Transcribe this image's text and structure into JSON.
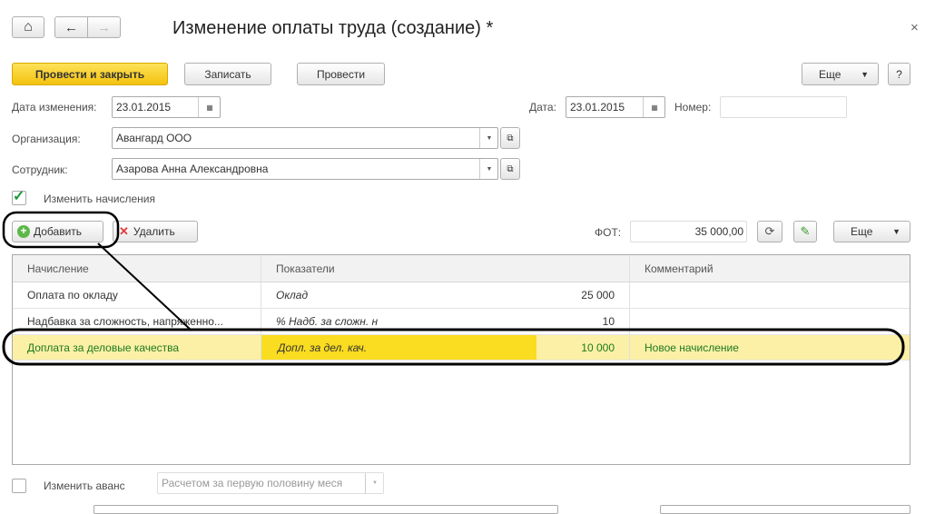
{
  "header": {
    "title": "Изменение оплаты труда (создание) *",
    "close": "×",
    "home": "⌂",
    "back": "←",
    "forward": "→"
  },
  "toolbar": {
    "post_close": "Провести и закрыть",
    "save": "Записать",
    "post": "Провести",
    "more": "Еще",
    "help": "?"
  },
  "form": {
    "change_date_label": "Дата изменения:",
    "change_date": "23.01.2015",
    "date_label": "Дата:",
    "date": "23.01.2015",
    "number_label": "Номер:",
    "number": "",
    "org_label": "Организация:",
    "org": "Авангард ООО",
    "employee_label": "Сотрудник:",
    "employee": "Азарова Анна Александровна",
    "change_accruals_label": "Изменить начисления",
    "change_accruals_checked": true
  },
  "table_toolbar": {
    "add": "Добавить",
    "delete": "Удалить",
    "fot_label": "ФОТ:",
    "fot": "35 000,00",
    "more": "Еще"
  },
  "table": {
    "columns": [
      "Начисление",
      "Показатели",
      "Комментарий"
    ],
    "rows": [
      {
        "accrual": "Оплата по окладу",
        "indicator": "Оклад",
        "value": "25 000",
        "comment": ""
      },
      {
        "accrual": "Надбавка за сложность, напряженно...",
        "indicator": "%  Надб. за сложн. н",
        "value": "10",
        "comment": ""
      },
      {
        "accrual": "Доплата за деловые качества",
        "indicator": "Допл. за дел. кач.",
        "value": "10 000",
        "comment": "Новое начисление"
      }
    ]
  },
  "advance": {
    "label": "Изменить аванс",
    "checked": false,
    "method": "Расчетом за первую половину меся"
  }
}
